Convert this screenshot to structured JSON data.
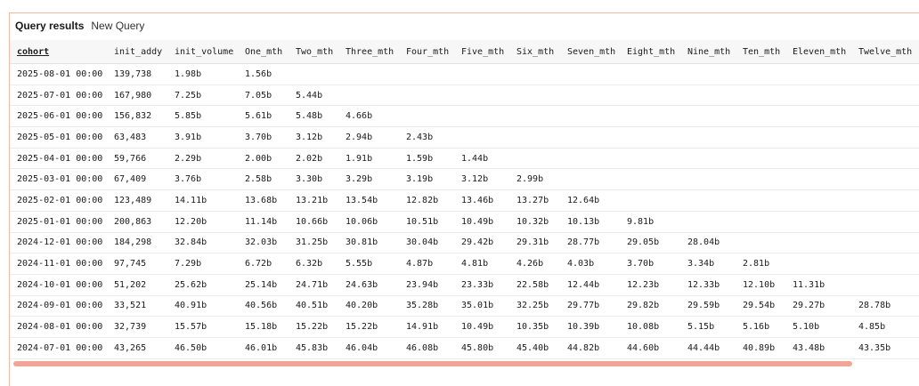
{
  "header": {
    "title": "Query results",
    "subtitle": "New Query"
  },
  "colors": {
    "border": "#f4b8a8",
    "scrollbar": "#f2a596",
    "header_bg": "#f7f7f7"
  },
  "table": {
    "columns": [
      "cohort",
      "init_addy",
      "init_volume",
      "One_mth",
      "Two_mth",
      "Three_mth",
      "Four_mth",
      "Five_mth",
      "Six_mth",
      "Seven_mth",
      "Eight_mth",
      "Nine_mth",
      "Ten_mth",
      "Eleven_mth",
      "Twelve_mth"
    ],
    "rows": [
      [
        "2025-08-01 00:00",
        "139,738",
        "1.98b",
        "1.56b",
        "",
        "",
        "",
        "",
        "",
        "",
        "",
        "",
        "",
        "",
        ""
      ],
      [
        "2025-07-01 00:00",
        "167,980",
        "7.25b",
        "7.05b",
        "5.44b",
        "",
        "",
        "",
        "",
        "",
        "",
        "",
        "",
        "",
        ""
      ],
      [
        "2025-06-01 00:00",
        "156,832",
        "5.85b",
        "5.61b",
        "5.48b",
        "4.66b",
        "",
        "",
        "",
        "",
        "",
        "",
        "",
        "",
        ""
      ],
      [
        "2025-05-01 00:00",
        "63,483",
        "3.91b",
        "3.70b",
        "3.12b",
        "2.94b",
        "2.43b",
        "",
        "",
        "",
        "",
        "",
        "",
        "",
        ""
      ],
      [
        "2025-04-01 00:00",
        "59,766",
        "2.29b",
        "2.00b",
        "2.02b",
        "1.91b",
        "1.59b",
        "1.44b",
        "",
        "",
        "",
        "",
        "",
        "",
        ""
      ],
      [
        "2025-03-01 00:00",
        "67,409",
        "3.76b",
        "2.58b",
        "3.30b",
        "3.29b",
        "3.19b",
        "3.12b",
        "2.99b",
        "",
        "",
        "",
        "",
        "",
        ""
      ],
      [
        "2025-02-01 00:00",
        "123,489",
        "14.11b",
        "13.68b",
        "13.21b",
        "13.54b",
        "12.82b",
        "13.46b",
        "13.27b",
        "12.64b",
        "",
        "",
        "",
        "",
        ""
      ],
      [
        "2025-01-01 00:00",
        "200,863",
        "12.20b",
        "11.14b",
        "10.66b",
        "10.06b",
        "10.51b",
        "10.49b",
        "10.32b",
        "10.13b",
        "9.81b",
        "",
        "",
        "",
        ""
      ],
      [
        "2024-12-01 00:00",
        "184,298",
        "32.84b",
        "32.03b",
        "31.25b",
        "30.81b",
        "30.04b",
        "29.42b",
        "29.31b",
        "28.77b",
        "29.05b",
        "28.04b",
        "",
        "",
        ""
      ],
      [
        "2024-11-01 00:00",
        "97,745",
        "7.29b",
        "6.72b",
        "6.32b",
        "5.55b",
        "4.87b",
        "4.81b",
        "4.26b",
        "4.03b",
        "3.70b",
        "3.34b",
        "2.81b",
        "",
        ""
      ],
      [
        "2024-10-01 00:00",
        "51,202",
        "25.62b",
        "25.14b",
        "24.71b",
        "24.63b",
        "23.94b",
        "23.33b",
        "22.58b",
        "12.44b",
        "12.23b",
        "12.33b",
        "12.10b",
        "11.31b",
        ""
      ],
      [
        "2024-09-01 00:00",
        "33,521",
        "40.91b",
        "40.56b",
        "40.51b",
        "40.20b",
        "35.28b",
        "35.01b",
        "32.25b",
        "29.77b",
        "29.82b",
        "29.59b",
        "29.54b",
        "29.27b",
        "28.78b"
      ],
      [
        "2024-08-01 00:00",
        "32,739",
        "15.57b",
        "15.18b",
        "15.22b",
        "15.22b",
        "14.91b",
        "10.49b",
        "10.35b",
        "10.39b",
        "10.08b",
        "5.15b",
        "5.16b",
        "5.10b",
        "4.85b"
      ],
      [
        "2024-07-01 00:00",
        "43,265",
        "46.50b",
        "46.01b",
        "45.83b",
        "46.04b",
        "46.08b",
        "45.80b",
        "45.40b",
        "44.82b",
        "44.60b",
        "44.44b",
        "40.89b",
        "43.48b",
        "43.35b"
      ]
    ]
  }
}
